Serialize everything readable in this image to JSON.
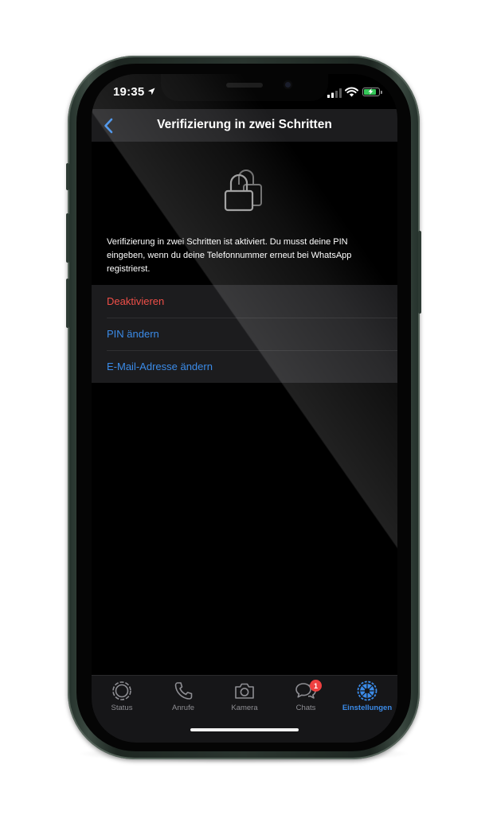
{
  "status_bar": {
    "time": "19:35",
    "icons": [
      "location-arrow-icon",
      "cellular-signal-icon",
      "wifi-icon",
      "battery-charging-icon"
    ],
    "battery_color": "#35c759"
  },
  "navigation": {
    "back_icon": "chevron-left-icon",
    "title": "Verifizierung in zwei Schritten"
  },
  "content": {
    "header_icon": "lock-icon",
    "description": "Verifizierung in zwei Schritten ist aktiviert. Du musst deine PIN eingeben, wenn du deine Telefonnummer erneut bei WhatsApp registrierst.",
    "actions": [
      {
        "label": "Deaktivieren",
        "color": "#ef4f48"
      },
      {
        "label": "PIN ändern",
        "color": "#3b8be8"
      },
      {
        "label": "E-Mail-Adresse ändern",
        "color": "#3b8be8"
      }
    ]
  },
  "tab_bar": {
    "tabs": [
      {
        "label": "Status",
        "icon": "status-ring-icon",
        "active": false
      },
      {
        "label": "Anrufe",
        "icon": "phone-icon",
        "active": false
      },
      {
        "label": "Kamera",
        "icon": "camera-icon",
        "active": false
      },
      {
        "label": "Chats",
        "icon": "chat-bubbles-icon",
        "active": false,
        "badge": "1"
      },
      {
        "label": "Einstellungen",
        "icon": "settings-gear-icon",
        "active": true
      }
    ],
    "active_color": "#3b8be8",
    "inactive_color": "#8e8e93"
  }
}
